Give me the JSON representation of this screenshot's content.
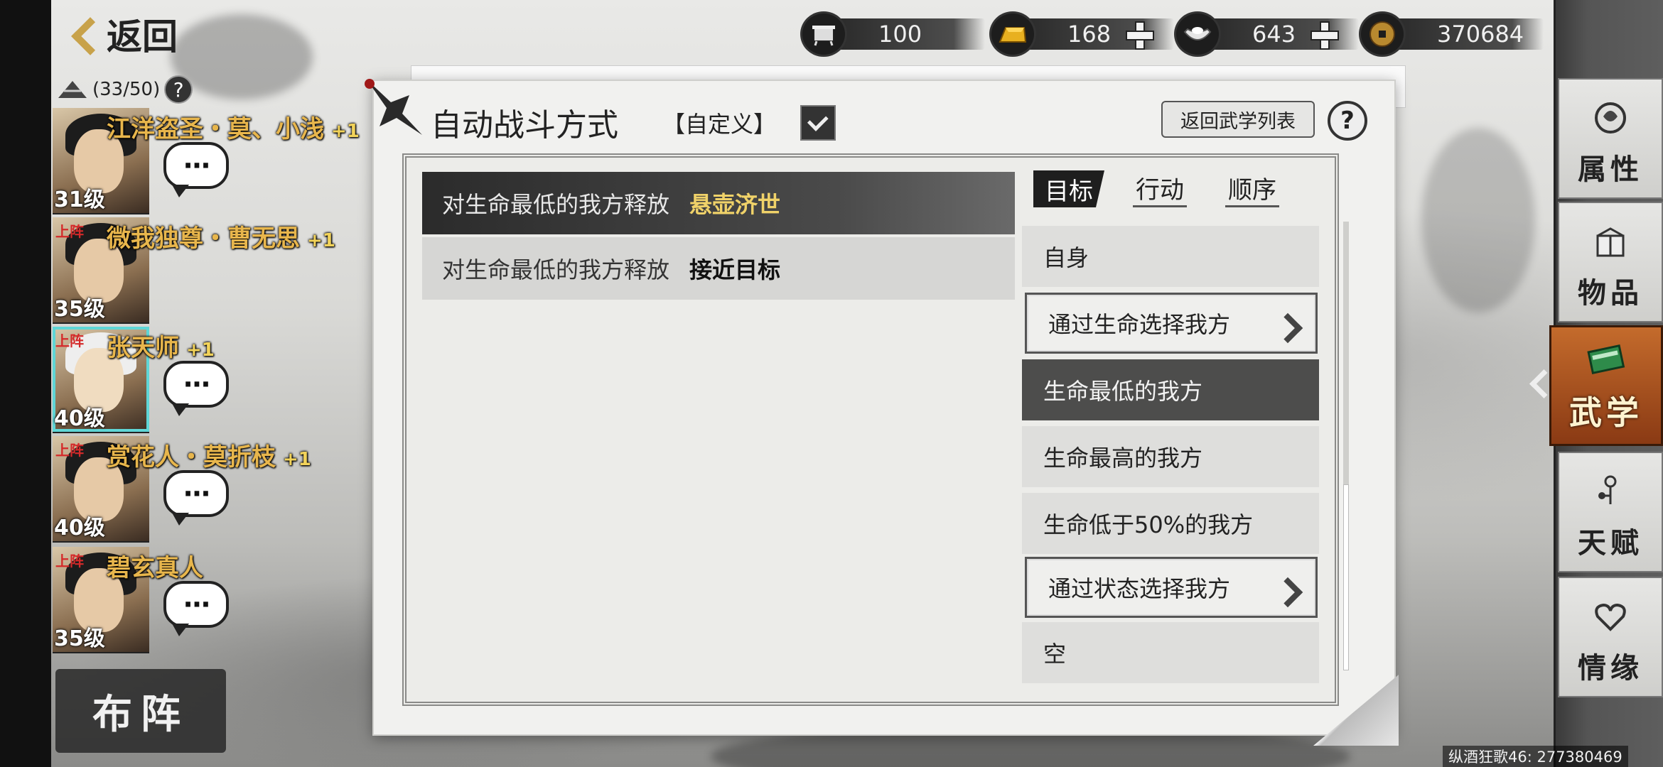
{
  "header": {
    "back_label": "返回",
    "resources": [
      {
        "icon": "cauldron-icon",
        "value": "100",
        "has_plus": false
      },
      {
        "icon": "gold-ingot-icon",
        "value": "168",
        "has_plus": true
      },
      {
        "icon": "silver-ingot-icon",
        "value": "643",
        "has_plus": true
      },
      {
        "icon": "copper-coin-icon",
        "value": "370684",
        "has_plus": false
      }
    ]
  },
  "roster": {
    "count": "(33/50)",
    "help": "?",
    "heroes": [
      {
        "name": "江洋盗圣・莫、小浅",
        "plus": "+1",
        "level": "31级",
        "onstage": "",
        "chat": "···"
      },
      {
        "name": "微我独尊・曹无思",
        "plus": "+1",
        "level": "35级",
        "onstage": "上阵",
        "chat": ""
      },
      {
        "name": "张天师",
        "plus": "+1",
        "level": "40级",
        "onstage": "上阵",
        "chat": "···"
      },
      {
        "name": "赏花人・莫折枝",
        "plus": "+1",
        "level": "40级",
        "onstage": "上阵",
        "chat": "···"
      },
      {
        "name": "碧玄真人",
        "plus": "",
        "level": "35级",
        "onstage": "上阵",
        "chat": "···"
      }
    ],
    "formation_label": "布阵"
  },
  "panel": {
    "title": "自动战斗方式",
    "mode": "【自定义】",
    "return_list_label": "返回武学列表",
    "help": "?",
    "rules": [
      {
        "condition": "对生命最低的我方释放",
        "skill": "悬壶济世",
        "selected": true
      },
      {
        "condition": "对生命最低的我方释放",
        "skill": "接近目标",
        "selected": false
      }
    ],
    "tabs": [
      "目标",
      "行动",
      "顺序"
    ],
    "options": [
      {
        "label": "自身",
        "style": "plain",
        "arrow": false
      },
      {
        "label": "通过生命选择我方",
        "style": "framed",
        "arrow": true
      },
      {
        "label": "生命最低的我方",
        "style": "active",
        "arrow": false
      },
      {
        "label": "生命最高的我方",
        "style": "plain",
        "arrow": false
      },
      {
        "label": "生命低于50%的我方",
        "style": "plain",
        "arrow": false
      },
      {
        "label": "通过状态选择我方",
        "style": "framed",
        "arrow": true
      },
      {
        "label": "空",
        "style": "plain",
        "arrow": false
      }
    ]
  },
  "side_menu": {
    "items": [
      {
        "label": "属性",
        "icon": "attribute-icon",
        "active": false
      },
      {
        "label": "物品",
        "icon": "item-box-icon",
        "active": false
      },
      {
        "label": "武学",
        "icon": "martial-book-icon",
        "active": true
      },
      {
        "label": "天赋",
        "icon": "talent-icon",
        "active": false
      },
      {
        "label": "情缘",
        "icon": "bond-heart-icon",
        "active": false
      }
    ]
  },
  "footer": {
    "uid": "纵酒狂歌46: 277380469"
  }
}
